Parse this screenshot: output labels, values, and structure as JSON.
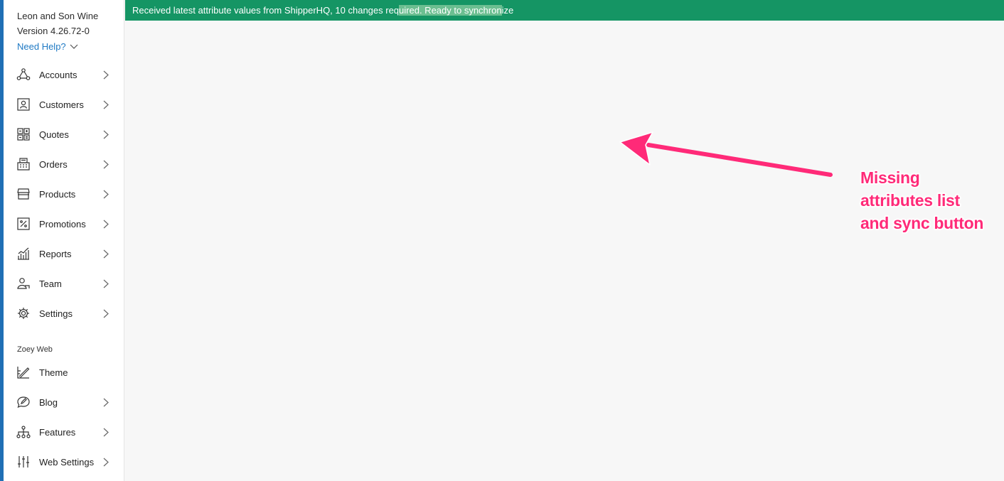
{
  "sidebar": {
    "store_name": "Leon and Son Wine",
    "version": "Version 4.26.72-0",
    "help_label": "Need Help?",
    "items": [
      {
        "label": "Accounts",
        "icon": "accounts-icon"
      },
      {
        "label": "Customers",
        "icon": "customers-icon"
      },
      {
        "label": "Quotes",
        "icon": "quotes-icon"
      },
      {
        "label": "Orders",
        "icon": "orders-icon"
      },
      {
        "label": "Products",
        "icon": "products-icon"
      },
      {
        "label": "Promotions",
        "icon": "promotions-icon"
      },
      {
        "label": "Reports",
        "icon": "reports-icon"
      },
      {
        "label": "Team",
        "icon": "team-icon"
      },
      {
        "label": "Settings",
        "icon": "gear-icon"
      }
    ],
    "web_section_label": "Zoey Web",
    "web_items": [
      {
        "label": "Theme",
        "icon": "theme-icon"
      },
      {
        "label": "Blog",
        "icon": "blog-icon"
      },
      {
        "label": "Features",
        "icon": "features-icon"
      },
      {
        "label": "Web Settings",
        "icon": "sliders-icon"
      }
    ]
  },
  "banner": {
    "text_part1": "Received latest attribute values from ShipperHQ, 10 changes req",
    "text_part2": "uired. Ready to synchron",
    "text_part3": "ize"
  },
  "annotation": {
    "line1": "Missing",
    "line2": "attributes list",
    "line3": "and sync button"
  },
  "colors": {
    "banner": "#159564",
    "banner_highlight": "#6cbf91",
    "link": "#1f7ac4",
    "annotation": "#ff2a78",
    "accent": "#1f6fb5"
  }
}
